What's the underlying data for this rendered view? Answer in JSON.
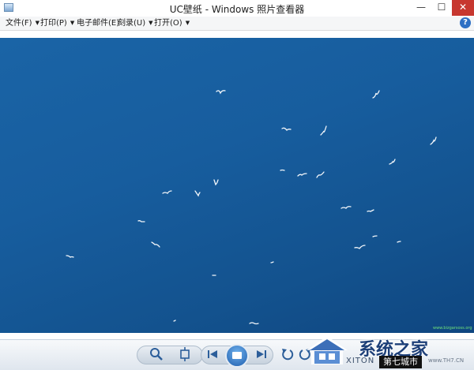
{
  "window": {
    "title": "UC壁纸 - Windows 照片查看器",
    "controls": {
      "minimize": "—",
      "maximize": "☐",
      "close": "✕"
    }
  },
  "menu": {
    "items": [
      {
        "label": "文件(F)"
      },
      {
        "label": "打印(P)"
      },
      {
        "label": "电子邮件(E)"
      },
      {
        "label": "刻录(U)"
      },
      {
        "label": "打开(O)"
      }
    ],
    "arrow": "▼",
    "help": "?"
  },
  "photo": {
    "description_icon": "seagulls-over-sea",
    "site_watermark": "www.bizgarsoss.org"
  },
  "toolbar": {
    "zoom_icon": "zoom-icon",
    "fit_icon": "fit-window-icon",
    "prev_icon": "previous-icon",
    "slideshow_icon": "slideshow-icon",
    "next_icon": "next-icon",
    "rotate_left_icon": "rotate-ccw-icon",
    "rotate_right_icon": "rotate-cw-icon",
    "delete_icon": "delete-icon"
  },
  "watermark": {
    "brand": "系统之家",
    "latin": "XITON",
    "sub": "第七城市",
    "url": "www.TH7.CN"
  },
  "colors": {
    "photo_top": "#1a64a6",
    "photo_bottom": "#0f4680",
    "close_button": "#c7372f",
    "accent": "#2d6fc4"
  }
}
